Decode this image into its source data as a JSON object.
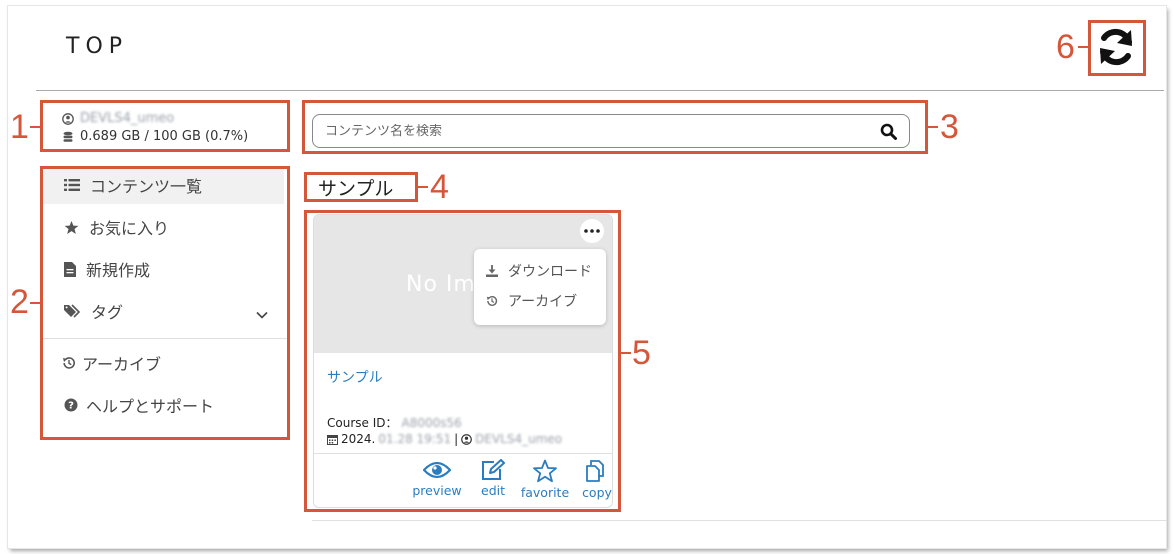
{
  "page": {
    "title": "TOP"
  },
  "user": {
    "username": "DEVLS4_umeo",
    "storage": "0.689 GB / 100 GB (0.7%)"
  },
  "sidebar": {
    "items": [
      {
        "label": "コンテンツ一覧",
        "icon": "list-icon",
        "active": true
      },
      {
        "label": "お気に入り",
        "icon": "star-icon"
      },
      {
        "label": "新規作成",
        "icon": "document-icon"
      },
      {
        "label": "タグ",
        "icon": "tags-icon"
      },
      {
        "label": "アーカイブ",
        "icon": "history-icon"
      },
      {
        "label": "ヘルプとサポート",
        "icon": "question-circle-icon"
      }
    ]
  },
  "search": {
    "placeholder": "コンテンツ名を検索"
  },
  "section": {
    "title": "サンプル"
  },
  "card": {
    "thumbnail_text": "No Im",
    "title": "サンプル",
    "course_id_label": "Course ID：",
    "course_id": "A8000s56",
    "date_visible": "2024.",
    "date_blurred": "01.28 19:51",
    "separator": "|",
    "author": "DEVLS4_umeo",
    "menu": [
      {
        "label": "ダウンロード",
        "icon": "download-icon"
      },
      {
        "label": "アーカイブ",
        "icon": "history-icon"
      }
    ],
    "actions": [
      {
        "label": "preview",
        "icon": "eye-icon"
      },
      {
        "label": "edit",
        "icon": "edit-icon"
      },
      {
        "label": "favorite",
        "icon": "star-outline-icon"
      },
      {
        "label": "copy",
        "icon": "copy-icon"
      }
    ]
  },
  "callouts": [
    "1",
    "2",
    "3",
    "4",
    "5",
    "6"
  ],
  "colors": {
    "callout": "#d4573a",
    "link": "#2a7dc0",
    "thumbnail": "#e6e6e6"
  }
}
